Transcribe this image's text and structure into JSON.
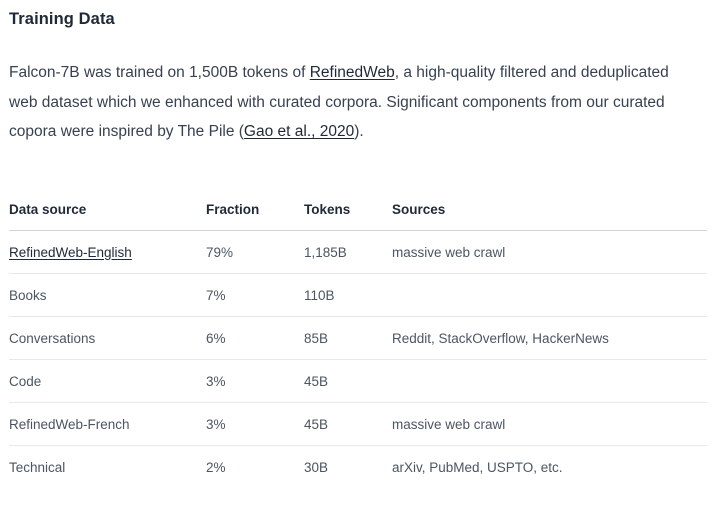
{
  "section": {
    "title": "Training Data"
  },
  "intro": {
    "part1": "Falcon-7B was trained on 1,500B tokens of ",
    "refinedweb_link": "RefinedWeb",
    "part2": ", a high-quality filtered and deduplicated web dataset which we enhanced with curated corpora. Significant components from our curated copora were inspired by The Pile (",
    "citation_link": "Gao et al., 2020",
    "part3": ")."
  },
  "table": {
    "headers": {
      "source": "Data source",
      "fraction": "Fraction",
      "tokens": "Tokens",
      "sources": "Sources"
    },
    "rows": [
      {
        "source": "RefinedWeb-English",
        "fraction": "79%",
        "tokens": "1,185B",
        "sources": "massive web crawl"
      },
      {
        "source": "Books",
        "fraction": "7%",
        "tokens": "110B",
        "sources": ""
      },
      {
        "source": "Conversations",
        "fraction": "6%",
        "tokens": "85B",
        "sources": "Reddit, StackOverflow, HackerNews"
      },
      {
        "source": "Code",
        "fraction": "3%",
        "tokens": "45B",
        "sources": ""
      },
      {
        "source": "RefinedWeb-French",
        "fraction": "3%",
        "tokens": "45B",
        "sources": "massive web crawl"
      },
      {
        "source": "Technical",
        "fraction": "2%",
        "tokens": "30B",
        "sources": "arXiv, PubMed, USPTO, etc."
      }
    ]
  }
}
